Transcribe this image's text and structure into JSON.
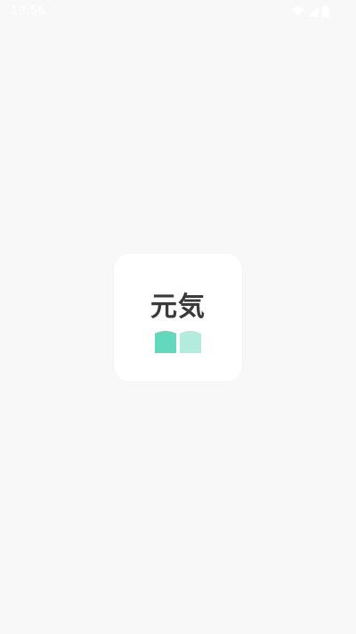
{
  "status_bar": {
    "time": "19:56",
    "icons": [
      "wifi-icon",
      "cellular-signal-icon",
      "battery-icon"
    ],
    "icon_color": "#ffffff"
  },
  "splash": {
    "logo_text": "元気",
    "logo_icon": "open-book-icon",
    "text_color": "#3a3a3a",
    "book_left_color": "#63d8bc",
    "book_right_color": "#b3ecdc",
    "background_color": "#f8f8f8",
    "card_color": "#ffffff"
  }
}
